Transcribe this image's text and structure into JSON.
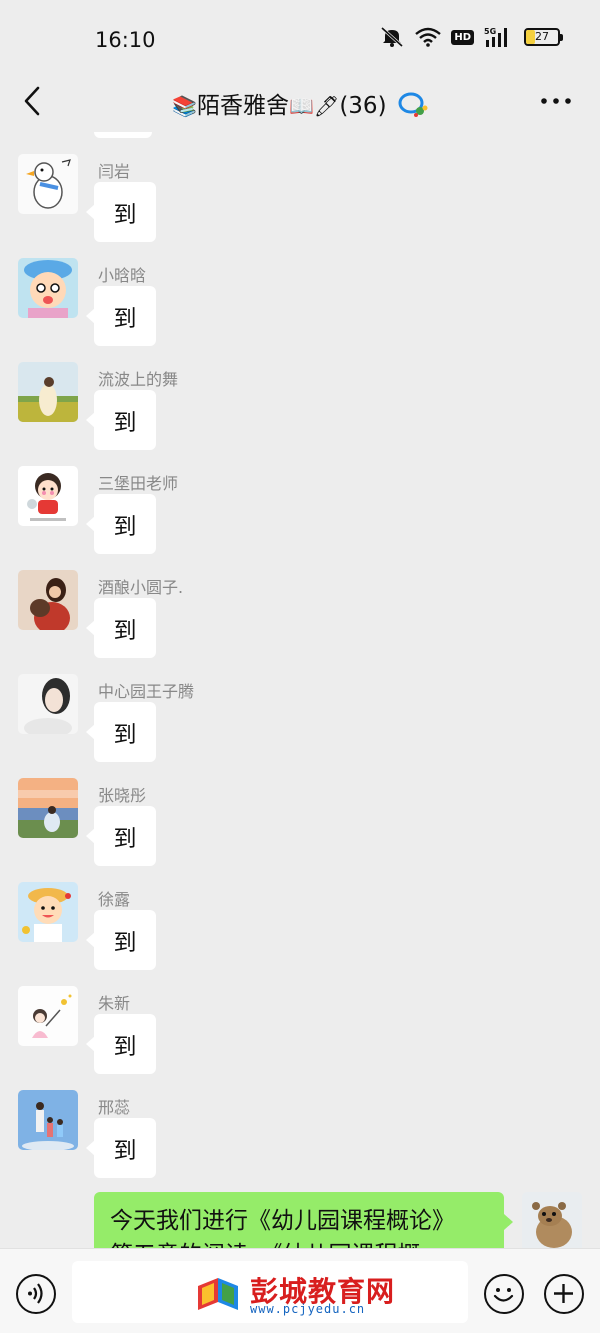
{
  "status_bar": {
    "time": "16:10",
    "network": "5G",
    "hd": "HD",
    "battery": "27",
    "battery_level": 0.27
  },
  "header": {
    "title": "陌香雅舍",
    "member_count": "(36)",
    "title_emoji_left": "📚",
    "title_emoji_right": "📖🖊"
  },
  "messages": [
    {
      "sender": "闫岩",
      "text": "到",
      "avatar": "goose-avatar"
    },
    {
      "sender": "小晗晗",
      "text": "到",
      "avatar": "cartoon-kid-avatar"
    },
    {
      "sender": "流波上的舞",
      "text": "到",
      "avatar": "field-girl-avatar"
    },
    {
      "sender": "三堡田老师",
      "text": "到",
      "avatar": "cartoon-girl-avatar"
    },
    {
      "sender": "酒酿小圆子.",
      "text": "到",
      "avatar": "portrait-avatar"
    },
    {
      "sender": "中心园王子腾",
      "text": "到",
      "avatar": "selfie-avatar"
    },
    {
      "sender": "张晓彤",
      "text": "到",
      "avatar": "beach-avatar"
    },
    {
      "sender": "徐露",
      "text": "到",
      "avatar": "cartoon-boy-avatar"
    },
    {
      "sender": "朱新",
      "text": "到",
      "avatar": "sketch-girl-avatar"
    },
    {
      "sender": "邢蕊",
      "text": "到",
      "avatar": "family-avatar"
    }
  ],
  "my_message": {
    "line1": "今天我们进行《幼儿园课程概论》",
    "line2": "第五章的阅读。《幼儿园课程概",
    "avatar": "meerkat-avatar"
  },
  "input_bar": {
    "watermark_title": "彭城教育网",
    "watermark_url": "www.pcjyedu.cn"
  },
  "colors": {
    "background": "#ededed",
    "bubble_in": "#ffffff",
    "bubble_out": "#95ec69",
    "sender_name": "#888888",
    "watermark_red": "#d81e1e",
    "watermark_blue": "#1565c0"
  },
  "icons": {
    "back": "back-arrow-icon",
    "more": "more-dots-icon",
    "voice": "voice-icon",
    "emoji": "emoji-icon",
    "plus": "plus-icon"
  }
}
